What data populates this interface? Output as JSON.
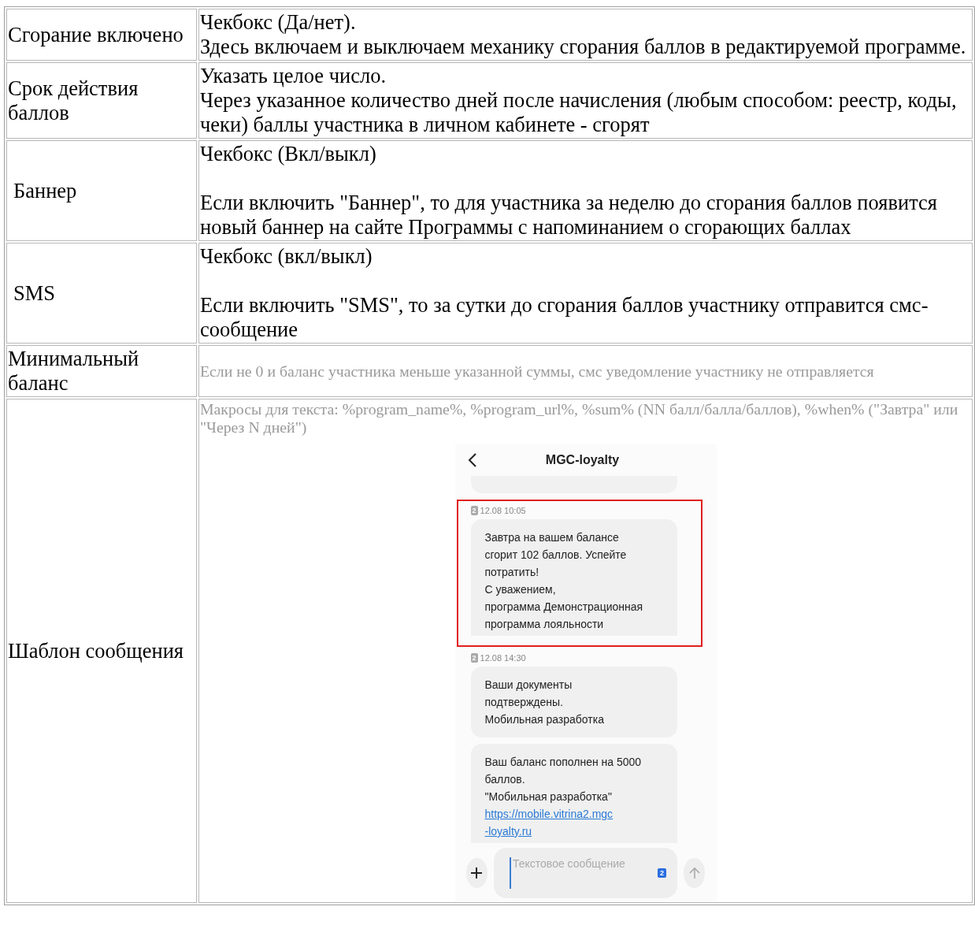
{
  "table": {
    "rows": [
      {
        "label": "Сгорание включено",
        "kind": "text",
        "blank_line": false,
        "paragraphs": [
          "Чекбокс (Да/нет).",
          "Здесь включаем и выключаем механику сгорания баллов в редактируемой программе."
        ]
      },
      {
        "label": "Срок действия баллов",
        "kind": "text",
        "blank_line": false,
        "paragraphs": [
          "Указать целое число.",
          "Через указанное количество дней после начисления (любым способом: реестр, коды, чеки) баллы участника в личном кабинете - сгорят"
        ]
      },
      {
        "label": "Баннер",
        "kind": "text",
        "blank_line": true,
        "paragraphs": [
          "Чекбокс (Вкл/выкл)",
          "Если включить \"Баннер\", то для участника за неделю до сгорания баллов появится новый баннер на сайте Программы с напоминанием о сгорающих баллах"
        ]
      },
      {
        "label": "SMS",
        "kind": "text",
        "blank_line": true,
        "paragraphs": [
          "Чекбокс (вкл/выкл)",
          "Если включить \"SMS\", то за сутки до сгорания баллов участнику отправится смс-сообщение"
        ]
      },
      {
        "label": "Минимальный баланс",
        "kind": "hint",
        "paragraphs": [
          "Если не 0 и баланс участника меньше указанной суммы, смс уведомление участнику не отправляется"
        ]
      },
      {
        "label": "Шаблон сообщения",
        "kind": "hint",
        "paragraphs": [
          "Макросы для текста: %program_name%, %program_url%, %sum% (NN балл/балла/баллов), %when% (\"Завтра\" или \"Через N дней\")"
        ],
        "phone": {
          "title": "MGC-loyalty",
          "input": {
            "placeholder": "Текстовое сообщение",
            "sim": "2"
          },
          "messages": [
            {
              "time": "12.08 10:05",
              "sim": "2",
              "highlighted": true,
              "bubbles": [
                {
                  "lines": [
                    "Завтра на вашем балансе",
                    "сгорит 102 баллов. Успейте",
                    "потратить!",
                    "С уважением,",
                    "программа Демонстрационная",
                    "программа лояльности"
                  ]
                }
              ]
            },
            {
              "time": "12.08 14:30",
              "sim": "2",
              "highlighted": false,
              "bubbles": [
                {
                  "lines": [
                    "Ваши документы",
                    "подтверждены.",
                    "Мобильная разработка"
                  ]
                },
                {
                  "lines": [
                    "Ваш баланс пополнен на 5000",
                    "баллов.",
                    "\"Мобильная разработка\""
                  ],
                  "link_lines": [
                    "https://mobile.vitrina2.mgc",
                    "-loyalty.ru"
                  ]
                }
              ]
            }
          ]
        }
      }
    ]
  }
}
